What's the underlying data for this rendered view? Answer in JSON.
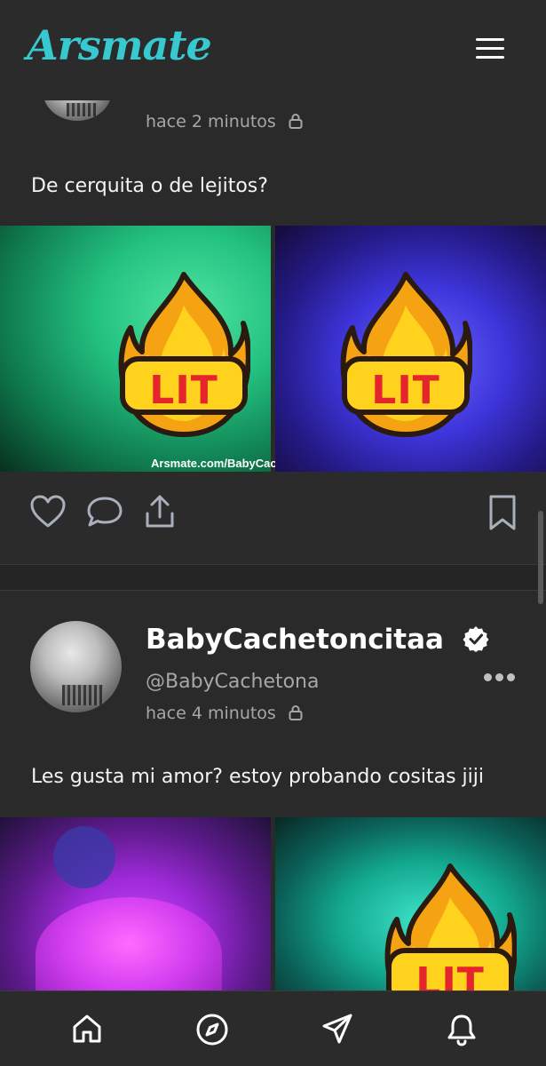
{
  "app": {
    "logo_text": "Arsmate",
    "accent_color": "#38c9d0"
  },
  "header": {
    "menu_icon": "hamburger-menu-icon"
  },
  "posts": [
    {
      "time": "hace 2 minutos",
      "text": "De cerquita o de lejitos?",
      "watermark": "Arsmate.com/BabyCache",
      "overlay": "LIT"
    },
    {
      "username": "BabyCachetoncitaa",
      "handle": "@BabyCachetona",
      "time": "hace 4 minutos",
      "text": "Les gusta mi amor? estoy probando cositas jiji",
      "overlay": "LIT"
    }
  ],
  "actions": {
    "icons": [
      "heart-icon",
      "comment-icon",
      "share-icon",
      "bookmark-icon"
    ]
  },
  "bottom_nav": {
    "items": [
      "home-icon",
      "explore-icon",
      "messages-icon",
      "notifications-icon"
    ]
  }
}
